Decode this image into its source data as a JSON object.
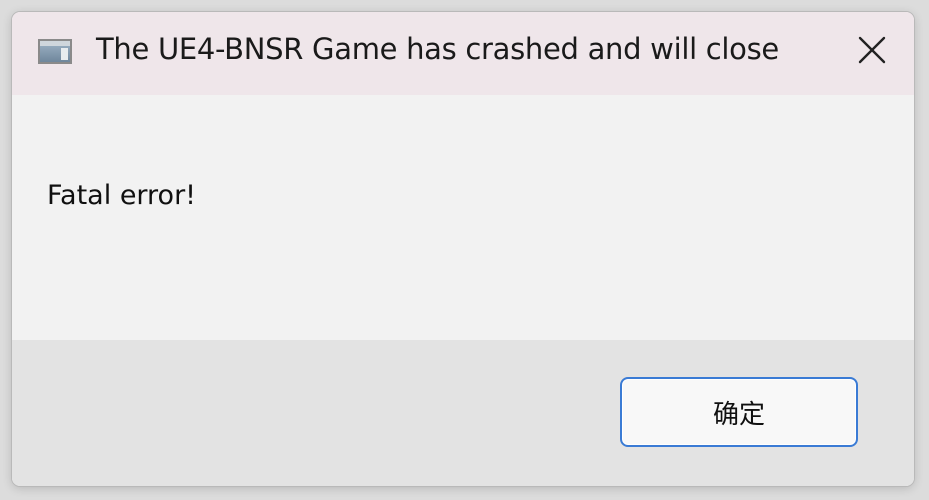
{
  "window": {
    "title": "The UE4-BNSR Game has crashed and will close",
    "icon": "app-window-icon",
    "close_icon": "close-icon"
  },
  "content": {
    "message": "Fatal error!"
  },
  "footer": {
    "ok_label": "确定"
  },
  "colors": {
    "titlebar_bg": "#efe6ea",
    "content_bg": "#f2f2f2",
    "footer_bg": "#e3e3e3",
    "button_border": "#3a7bd5"
  }
}
